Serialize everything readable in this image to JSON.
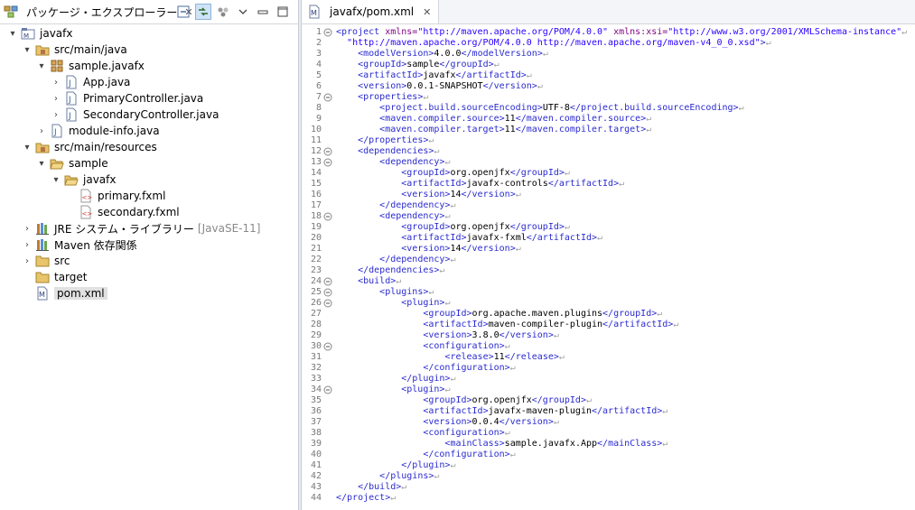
{
  "package_explorer": {
    "tab_label": "パッケージ・エクスプローラー",
    "items": [
      {
        "label": "javafx",
        "extra": ""
      },
      {
        "label": "src/main/java",
        "extra": ""
      },
      {
        "label": "sample.javafx",
        "extra": ""
      },
      {
        "label": "App.java",
        "extra": ""
      },
      {
        "label": "PrimaryController.java",
        "extra": ""
      },
      {
        "label": "SecondaryController.java",
        "extra": ""
      },
      {
        "label": "module-info.java",
        "extra": ""
      },
      {
        "label": "src/main/resources",
        "extra": ""
      },
      {
        "label": "sample",
        "extra": ""
      },
      {
        "label": "javafx",
        "extra": ""
      },
      {
        "label": "primary.fxml",
        "extra": ""
      },
      {
        "label": "secondary.fxml",
        "extra": ""
      },
      {
        "label": "JRE システム・ライブラリー",
        "extra": "[JavaSE-11]"
      },
      {
        "label": "Maven 依存関係",
        "extra": ""
      },
      {
        "label": "src",
        "extra": ""
      },
      {
        "label": "target",
        "extra": ""
      },
      {
        "label": "pom.xml",
        "extra": ""
      }
    ]
  },
  "editor": {
    "tab_label": "javafx/pom.xml",
    "lines": [
      "<project xmlns=\"http://maven.apache.org/POM/4.0.0\" xmlns:xsi=\"http://www.w3.org/2001/XMLSchema-instance\"",
      "  xsi:schemaLocation=\"http://maven.apache.org/POM/4.0.0 http://maven.apache.org/maven-v4_0_0.xsd\">",
      "    <modelVersion>4.0.0</modelVersion>",
      "    <groupId>sample</groupId>",
      "    <artifactId>javafx</artifactId>",
      "    <version>0.0.1-SNAPSHOT</version>",
      "    <properties>",
      "        <project.build.sourceEncoding>UTF-8</project.build.sourceEncoding>",
      "        <maven.compiler.source>11</maven.compiler.source>",
      "        <maven.compiler.target>11</maven.compiler.target>",
      "    </properties>",
      "    <dependencies>",
      "        <dependency>",
      "            <groupId>org.openjfx</groupId>",
      "            <artifactId>javafx-controls</artifactId>",
      "            <version>14</version>",
      "        </dependency>",
      "        <dependency>",
      "            <groupId>org.openjfx</groupId>",
      "            <artifactId>javafx-fxml</artifactId>",
      "            <version>14</version>",
      "        </dependency>",
      "    </dependencies>",
      "    <build>",
      "        <plugins>",
      "            <plugin>",
      "                <groupId>org.apache.maven.plugins</groupId>",
      "                <artifactId>maven-compiler-plugin</artifactId>",
      "                <version>3.8.0</version>",
      "                <configuration>",
      "                    <release>11</release>",
      "                </configuration>",
      "            </plugin>",
      "            <plugin>",
      "                <groupId>org.openjfx</groupId>",
      "                <artifactId>javafx-maven-plugin</artifactId>",
      "                <version>0.0.4</version>",
      "                <configuration>",
      "                    <mainClass>sample.javafx.App</mainClass>",
      "                </configuration>",
      "            </plugin>",
      "        </plugins>",
      "    </build>",
      "</project>"
    ],
    "line_numbers": [
      "1",
      "2",
      "3",
      "4",
      "5",
      "6",
      "7",
      "8",
      "9",
      "10",
      "11",
      "12",
      "13",
      "14",
      "15",
      "16",
      "17",
      "18",
      "19",
      "20",
      "21",
      "22",
      "23",
      "24",
      "25",
      "26",
      "27",
      "28",
      "29",
      "30",
      "31",
      "32",
      "33",
      "34",
      "35",
      "36",
      "37",
      "38",
      "39",
      "40",
      "41",
      "42",
      "43",
      "44"
    ],
    "colors": {
      "tag": "#2b2bd0",
      "attr": "#7f007f",
      "value": "#2a00ff"
    }
  }
}
